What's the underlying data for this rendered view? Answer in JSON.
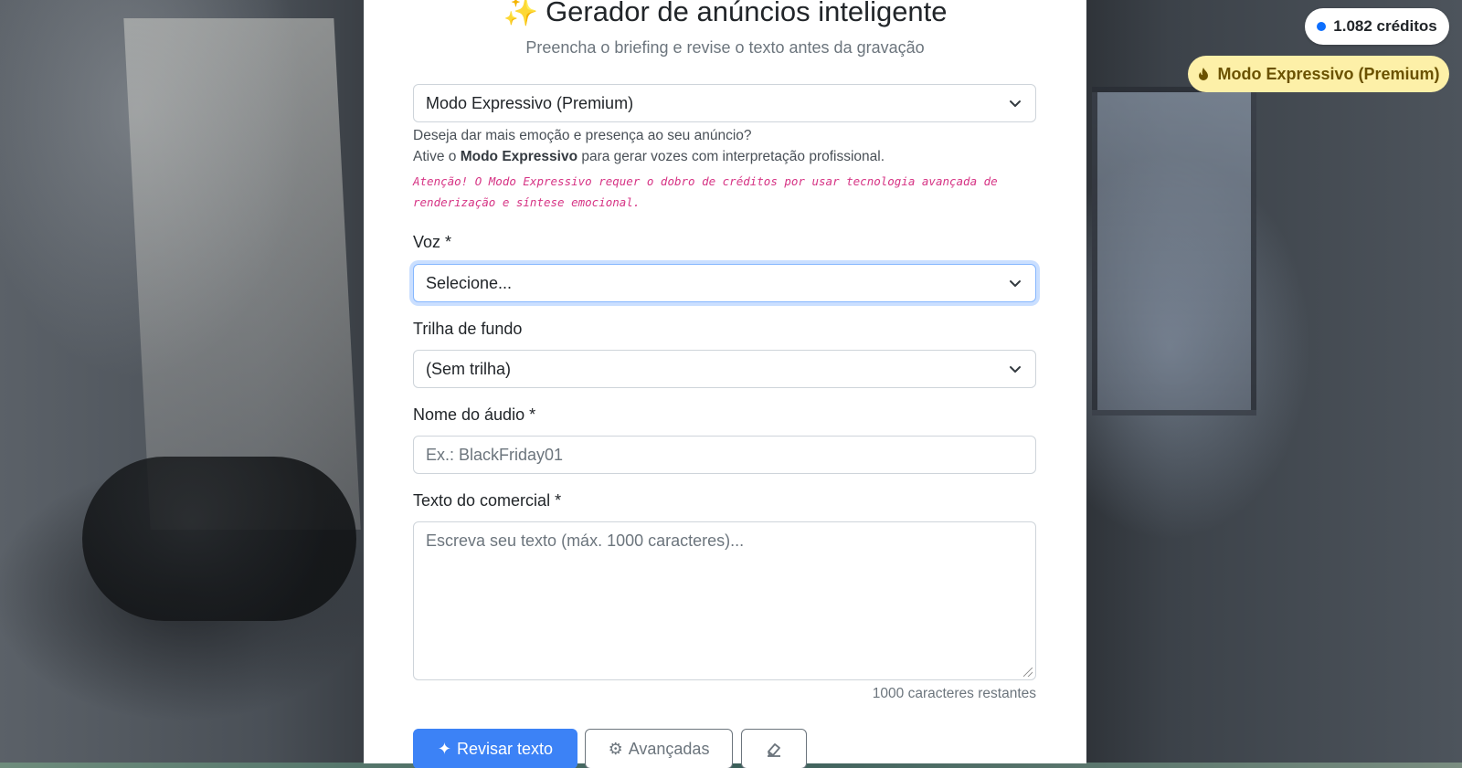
{
  "header": {
    "title": "Gerador de anúncios inteligente",
    "title_icon": "sparkles-icon",
    "subtitle": "Preencha o briefing e revise o texto antes da gravação"
  },
  "mode_select": {
    "value": "Modo Expressivo (Premium)"
  },
  "mode_help": {
    "line1": "Deseja dar mais emoção e presença ao seu anúncio?",
    "line2_prefix": "Ative o ",
    "line2_bold": "Modo Expressivo",
    "line2_suffix": " para gerar vozes com interpretação profissional.",
    "warning": "Atenção! O Modo Expressivo requer o dobro de créditos por usar tecnologia avançada de renderização e síntese emocional."
  },
  "voice": {
    "label": "Voz *",
    "value": "Selecione..."
  },
  "track": {
    "label": "Trilha de fundo",
    "value": "(Sem trilha)"
  },
  "audio_name": {
    "label": "Nome do áudio *",
    "placeholder": "Ex.: BlackFriday01"
  },
  "commercial_text": {
    "label": "Texto do comercial *",
    "placeholder": "Escreva seu texto (máx. 1000 caracteres)...",
    "counter": "1000 caracteres restantes"
  },
  "actions": {
    "review_label": "Revisar texto",
    "advanced_label": "Avançadas",
    "clear_icon": "eraser-icon"
  },
  "badges": {
    "credits": "1.082 créditos",
    "premium": "Modo Expressivo (Premium)",
    "premium_icon": "flame-icon"
  },
  "colors": {
    "primary": "#3c82f6",
    "warning_text": "#d63384",
    "premium_bg": "#fdf0a8"
  }
}
